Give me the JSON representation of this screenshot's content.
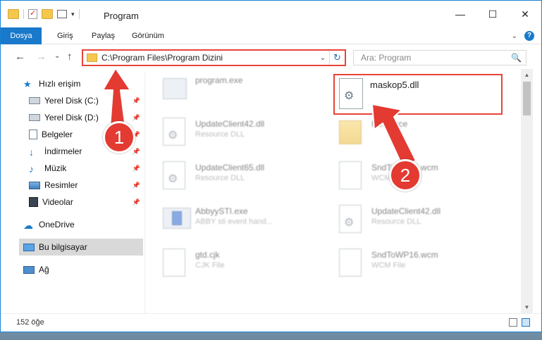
{
  "window": {
    "title": "Program",
    "controls": [
      "—",
      "☐",
      "✕"
    ]
  },
  "ribbon": {
    "tabs": [
      "Dosya",
      "Giriş",
      "Paylaş",
      "Görünüm"
    ],
    "help": "?"
  },
  "nav": {
    "back": "←",
    "forward": "→",
    "recent": "⌄",
    "up": "↑",
    "address": "C:\\Program Files\\Program Dizini",
    "dropdown": "⌄",
    "refresh": "↻",
    "search_placeholder": "Ara: Program",
    "search_icon": "🔍"
  },
  "sidebar": {
    "items": [
      {
        "label": "Hızlı erişim",
        "icon": "star-icon",
        "pinned": false
      },
      {
        "label": "Yerel Disk (C:)",
        "icon": "drive-icon",
        "pinned": true
      },
      {
        "label": "Yerel Disk (D:)",
        "icon": "drive-icon",
        "pinned": true
      },
      {
        "label": "Belgeler",
        "icon": "document-icon",
        "pinned": true
      },
      {
        "label": "İndirmeler",
        "icon": "download-icon",
        "pinned": true
      },
      {
        "label": "Müzik",
        "icon": "music-icon",
        "pinned": true
      },
      {
        "label": "Resimler",
        "icon": "pictures-icon",
        "pinned": true
      },
      {
        "label": "Videolar",
        "icon": "video-icon",
        "pinned": true
      },
      {
        "label": "OneDrive",
        "icon": "cloud-icon",
        "pinned": false
      },
      {
        "label": "Bu bilgisayar",
        "icon": "computer-icon",
        "pinned": false
      },
      {
        "label": "Ağ",
        "icon": "network-icon",
        "pinned": false
      }
    ],
    "pin_glyph": "📌"
  },
  "files": [
    {
      "name": "program.exe",
      "type": "",
      "icon": "exe-icon"
    },
    {
      "name": "maskop5.dll",
      "type": "",
      "icon": "dll-icon"
    },
    {
      "name": "UpdateClient42.dll",
      "type": "Resource DLL",
      "icon": "dll-icon"
    },
    {
      "name": "Resource",
      "type": "",
      "icon": "folder-icon"
    },
    {
      "name": "UpdateClient65.dll",
      "type": "Resource DLL",
      "icon": "dll-icon"
    },
    {
      "name": "SndToWP16.wcm",
      "type": "WCM File",
      "icon": "file-icon"
    },
    {
      "name": "AbbyySTI.exe",
      "type": "ABBY sti event hand...",
      "icon": "exe-icon"
    },
    {
      "name": "UpdateClient42.dll",
      "type": "Resource DLL",
      "icon": "dll-icon"
    },
    {
      "name": "gtd.cjk",
      "type": "CJK File",
      "icon": "file-icon"
    },
    {
      "name": "SndToWP16.wcm",
      "type": "WCM File",
      "icon": "file-icon"
    }
  ],
  "status": {
    "count": "152 öğe"
  },
  "annotations": [
    "1",
    "2"
  ],
  "colors": {
    "accent": "#1979ca",
    "highlight": "#e8443a"
  }
}
